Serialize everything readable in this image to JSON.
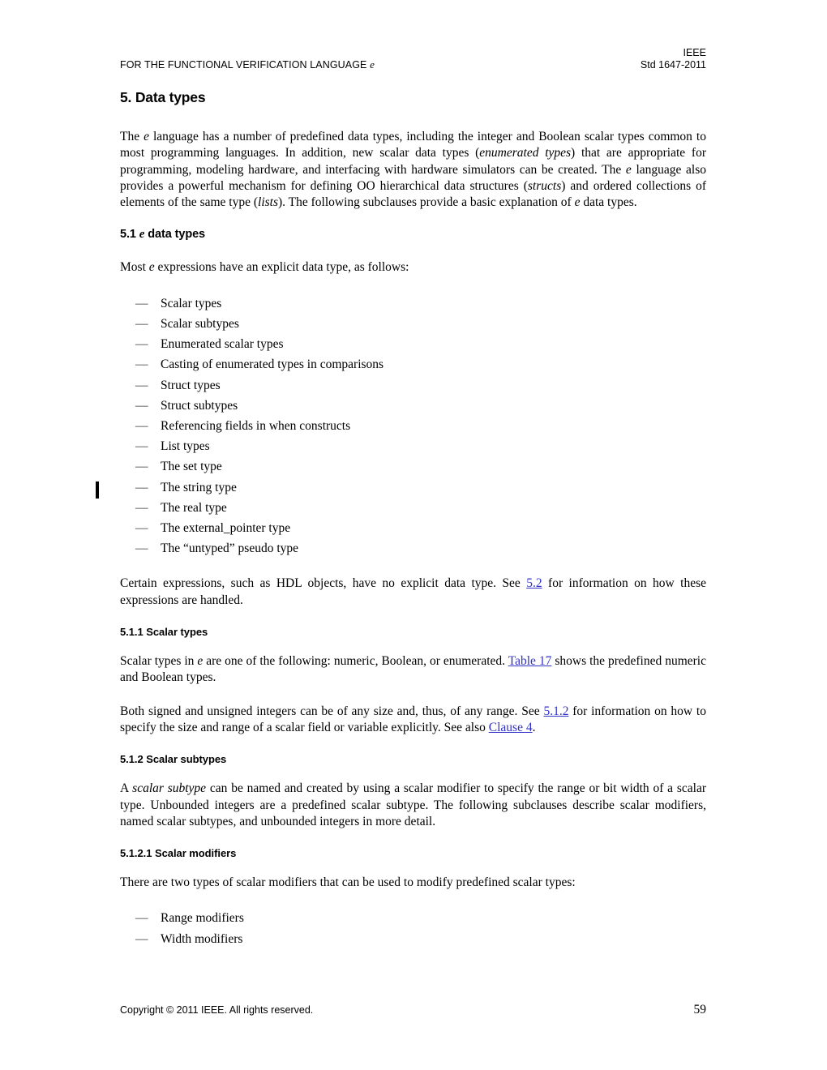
{
  "header": {
    "left_text_before_e": "FOR THE FUNCTIONAL VERIFICATION LANGUAGE ",
    "left_italic_e": "e",
    "right_line1": "IEEE",
    "right_line2": "Std 1647-2011"
  },
  "clause": {
    "title": "5. Data types",
    "intro_p1_part1": "The ",
    "intro_p1_e1": "e",
    "intro_p1_part2": " language has a number of predefined data types, including the integer and Boolean scalar types common to most programming languages. In addition, new scalar data types (",
    "intro_p1_italic1": "enumerated types",
    "intro_p1_part3": ") that are appropriate for programming, modeling hardware, and interfacing with hardware simulators can be created. The ",
    "intro_p1_e2": "e",
    "intro_p1_part4": " language also provides a powerful mechanism for defining OO hierarchical data structures (",
    "intro_p1_italic2": "structs",
    "intro_p1_part5": ") and ordered collections of elements of the same type (",
    "intro_p1_italic3": "lists",
    "intro_p1_part6": "). The following subclauses provide a basic explanation of ",
    "intro_p1_e3": "e",
    "intro_p1_part7": " data types."
  },
  "section_5_1": {
    "heading_number": "5.1 ",
    "heading_italic_e": "e",
    "heading_rest": " data types",
    "lead_part1": "Most ",
    "lead_italic_e": "e",
    "lead_part2": " expressions have an explicit data type, as follows:",
    "dash_marker": "—",
    "items": [
      "Scalar types",
      "Scalar subtypes",
      "Enumerated scalar types",
      "Casting of enumerated types in comparisons",
      "Struct types",
      "Struct subtypes",
      "Referencing fields in when constructs",
      "List types",
      "The set type",
      "The string type",
      "The real type",
      "The external_pointer type",
      "The “untyped” pseudo type"
    ],
    "after_list_part1": "Certain expressions, such as HDL objects, have no explicit data type. See ",
    "after_list_link": "5.2",
    "after_list_part2": " for information on how these expressions are handled."
  },
  "section_5_1_1": {
    "heading": "5.1.1 Scalar types",
    "p1_part1": "Scalar types in ",
    "p1_italic_e": "e",
    "p1_part2": " are one of the following: numeric, Boolean, or enumerated. ",
    "p1_link": "Table 17",
    "p1_part3": " shows the predefined numeric and Boolean types.",
    "p2_part1": "Both signed and unsigned integers can be of any size and, thus, of any range. See ",
    "p2_link1": "5.1.2",
    "p2_part2": " for information on how to specify the size and range of a scalar field or variable explicitly. See also ",
    "p2_link2": "Clause 4",
    "p2_part3": "."
  },
  "section_5_1_2": {
    "heading": "5.1.2 Scalar subtypes",
    "p1_part1": "A ",
    "p1_italic": "scalar subtype",
    "p1_part2": " can be named and created by using a scalar modifier to specify the range or bit width of a scalar type. Unbounded integers are a predefined scalar subtype. The following subclauses describe scalar modifiers, named scalar subtypes, and unbounded integers in more detail."
  },
  "section_5_1_2_1": {
    "heading": "5.1.2.1 Scalar modifiers",
    "lead": "There are two types of scalar modifiers that can be used to modify predefined scalar types:",
    "dash_marker": "—",
    "items": [
      "Range modifiers",
      "Width modifiers"
    ]
  },
  "footer": {
    "copyright": "Copyright © 2011 IEEE. All rights reserved.",
    "page_number": "59"
  },
  "marks": {
    "change_bar_color": "#000000"
  }
}
